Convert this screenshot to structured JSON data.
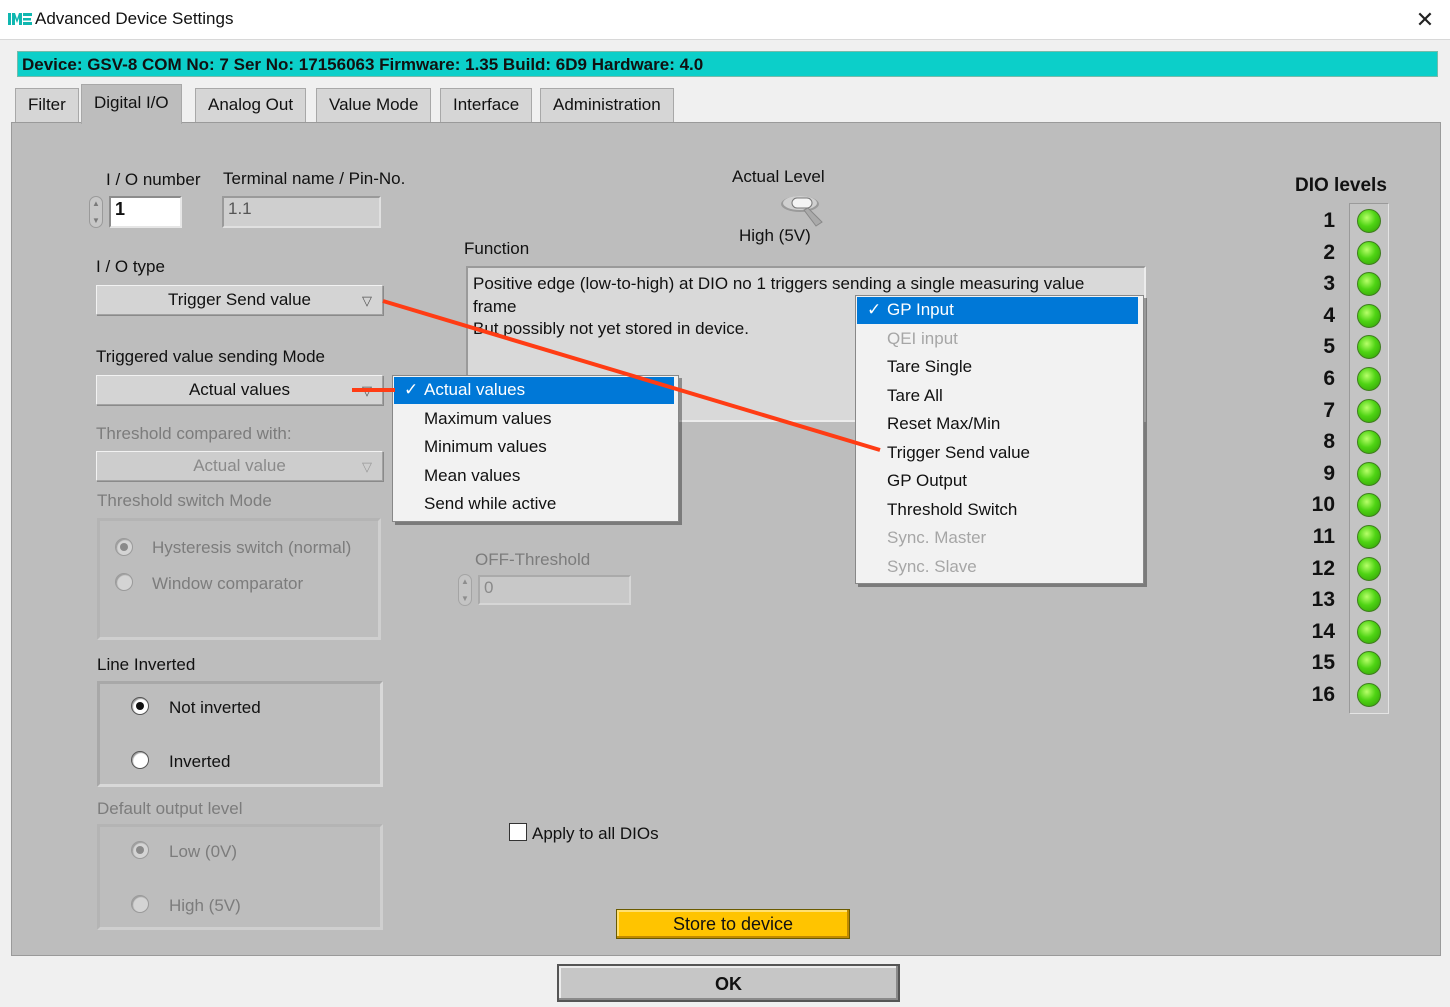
{
  "window": {
    "title": "Advanced Device Settings",
    "close_glyph": "✕"
  },
  "device_banner": "Device: GSV-8 COM No: 7 Ser No: 17156063 Firmware: 1.35 Build: 6D9 Hardware: 4.0",
  "tabs": [
    {
      "label": "Filter",
      "active": false
    },
    {
      "label": "Digital I/O",
      "active": true
    },
    {
      "label": "Analog Out",
      "active": false
    },
    {
      "label": "Value Mode",
      "active": false
    },
    {
      "label": "Interface",
      "active": false
    },
    {
      "label": "Administration",
      "active": false
    }
  ],
  "io_number": {
    "label": "I / O number",
    "value": "1"
  },
  "terminal": {
    "label": "Terminal name / Pin-No.",
    "value": "1.1"
  },
  "actual_level": {
    "label": "Actual Level",
    "state_text": "High (5V)"
  },
  "io_type": {
    "label": "I / O type",
    "value": "Trigger Send value"
  },
  "function": {
    "label": "Function",
    "line1": "Positive edge (low-to-high) at DIO no 1 triggers sending a single measuring value",
    "line2": "frame",
    "line3": "But possibly not yet stored in device."
  },
  "trigger_mode": {
    "label": "Triggered value sending Mode",
    "value": "Actual values"
  },
  "threshold_compared": {
    "label": "Threshold compared with:",
    "value": "Actual value"
  },
  "threshold_switch_mode": {
    "label": "Threshold switch Mode",
    "options": [
      "Hysteresis switch (normal)",
      "Window comparator"
    ]
  },
  "off_threshold": {
    "label": "OFF-Threshold",
    "value": "0"
  },
  "line_inverted": {
    "label": "Line Inverted",
    "options": [
      "Not inverted",
      "Inverted"
    ]
  },
  "default_output": {
    "label": "Default output level",
    "options": [
      "Low (0V)",
      "High (5V)"
    ]
  },
  "apply_all": {
    "label": "Apply to all DIOs",
    "checked": false
  },
  "store_button": "Store to device",
  "ok_button": "OK",
  "dio_levels": {
    "title": "DIO levels",
    "numbers": [
      "1",
      "2",
      "3",
      "4",
      "5",
      "6",
      "7",
      "8",
      "9",
      "10",
      "11",
      "12",
      "13",
      "14",
      "15",
      "16"
    ],
    "led_color": "#4fd414"
  },
  "mode_menu": {
    "check_glyph": "✓",
    "items": [
      "Actual values",
      "Maximum values",
      "Minimum values",
      "Mean values",
      "Send while active"
    ],
    "selected": "Actual values"
  },
  "io_type_menu": {
    "check_glyph": "✓",
    "items": [
      "GP Input",
      "QEI input",
      "Tare Single",
      "Tare All",
      "Reset Max/Min",
      "Trigger Send value",
      "GP Output",
      "Threshold Switch",
      "Sync. Master",
      "Sync. Slave"
    ],
    "selected": "GP Input",
    "disabled": [
      "QEI input",
      "Sync. Master",
      "Sync. Slave"
    ]
  },
  "colors": {
    "banner": "#0ccfc9",
    "panel": "#bdbdbd",
    "store_button": "#ffc400",
    "menu_highlight": "#0078d7",
    "annotation_line": "#ff3c14"
  }
}
